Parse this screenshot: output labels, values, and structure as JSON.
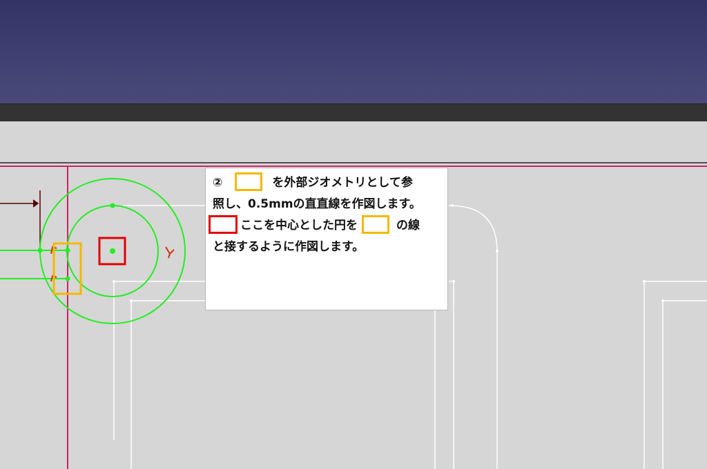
{
  "callout": {
    "line1": {
      "num": "②",
      "after_box": "を外部ジオメトリとして参"
    },
    "line2": {
      "text": "照し、0.5mmの直直線を作図します。"
    },
    "line3": {
      "after_red": "ここを中心とした円を",
      "after_orange": "の線"
    },
    "line4": {
      "text": "と接するように作図します。"
    }
  },
  "colors": {
    "header_bg": "#3d3d70",
    "toolbar": "#333333",
    "canvas_bg": "#d6d6d6",
    "sketch_green": "#22ee22",
    "edge_white": "#ffffff",
    "axis_magenta": "#cc2266",
    "highlight_orange": "#f5b800",
    "highlight_red": "#e00000"
  }
}
